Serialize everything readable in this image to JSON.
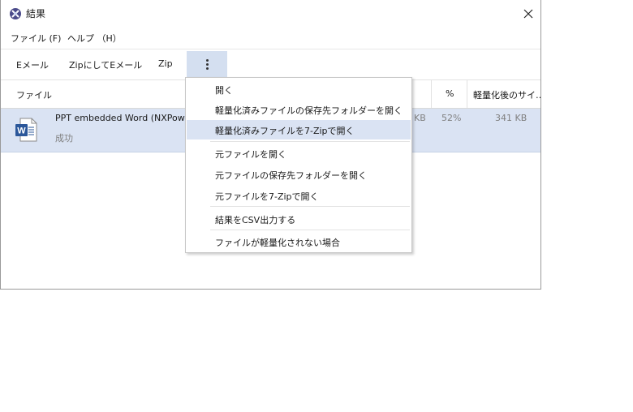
{
  "window": {
    "title": "結果",
    "close_glyph": "✕"
  },
  "menubar": {
    "file": "ファイル (F)",
    "help": "ヘルプ （H）"
  },
  "toolbar": {
    "email": "Eメール",
    "zip_email": "ZipにしてEメール",
    "zip": "Zip",
    "more_icon": "kebab-vertical"
  },
  "table": {
    "columns": {
      "file": "ファイル",
      "percent": "%",
      "size_after": "軽量化後のサイ…"
    },
    "rows": [
      {
        "name": "PPT embedded Word (NXPowe",
        "status": "成功",
        "size_partial": "KB",
        "percent": "52%",
        "size_after": "341 KB",
        "icon": "word-document-icon"
      }
    ]
  },
  "context_menu": {
    "items": [
      "開く",
      "軽量化済みファイルの保存先フォルダーを開く",
      "軽量化済みファイルを7-Zipで開く",
      "元ファイルを開く",
      "元ファイルの保存先フォルダーを開く",
      "元ファイルを7-Zipで開く",
      "結果をCSV出力する",
      "ファイルが軽量化されない場合"
    ],
    "highlighted_index": 2
  },
  "colors": {
    "selection": "#dae3f3",
    "word_blue": "#2b579a"
  }
}
